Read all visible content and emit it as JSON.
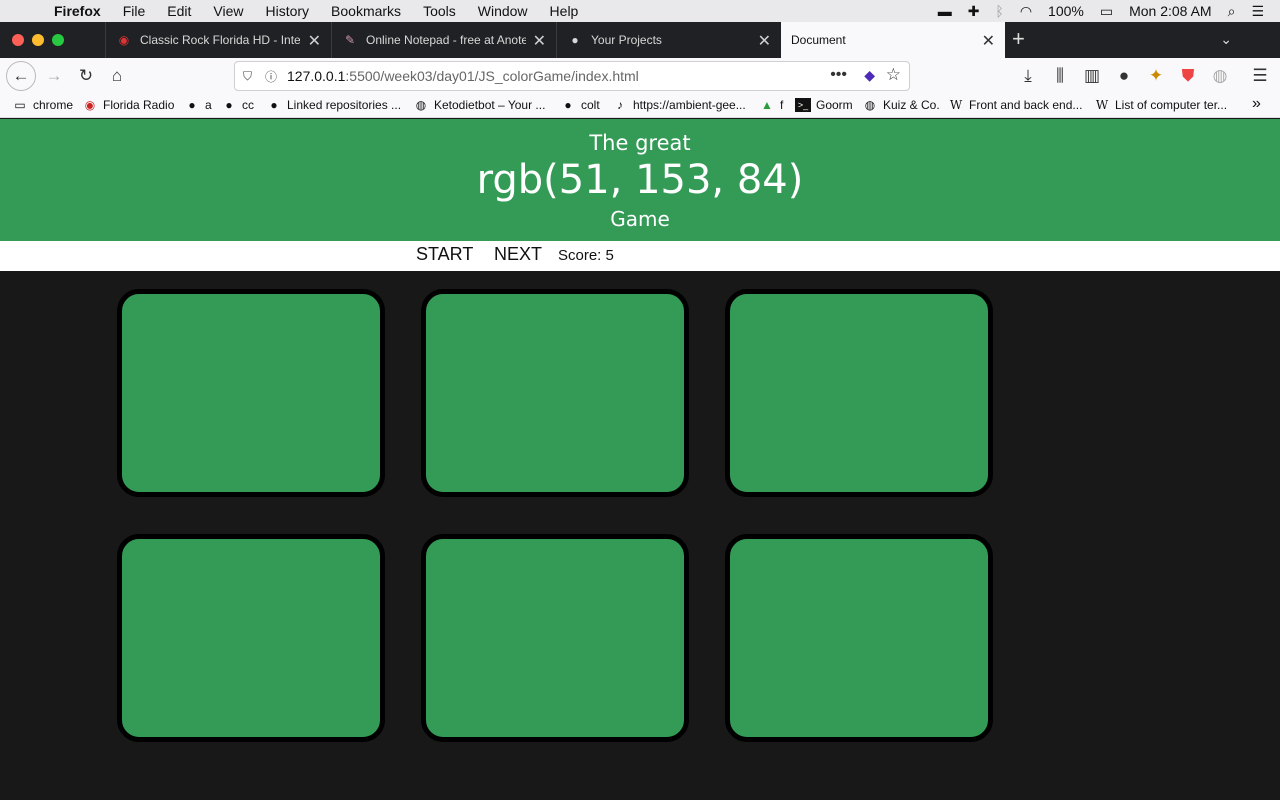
{
  "menubar": {
    "app": "Firefox",
    "items": [
      "File",
      "Edit",
      "View",
      "History",
      "Bookmarks",
      "Tools",
      "Window",
      "Help"
    ],
    "battery": "100%",
    "clock": "Mon 2:08 AM"
  },
  "tabs": [
    {
      "title": "Classic Rock Florida HD - Intern",
      "icon": "radio-icon"
    },
    {
      "title": "Online Notepad - free at Anotep",
      "icon": "notepad-icon"
    },
    {
      "title": "Your Projects",
      "icon": "github-icon"
    },
    {
      "title": "Document",
      "icon": "document-icon",
      "active": true
    }
  ],
  "url": {
    "host": "127.0.0.1",
    "path": ":5500/week03/day01/JS_colorGame/index.html"
  },
  "bookmarks": [
    {
      "label": "chrome",
      "icon": "folder-icon"
    },
    {
      "label": "Florida Radio",
      "icon": "radio-icon"
    },
    {
      "label": "a",
      "icon": "github-icon"
    },
    {
      "label": "cc",
      "icon": "github-icon"
    },
    {
      "label": "Linked repositories ...",
      "icon": "github-icon"
    },
    {
      "label": "Ketodietbot – Your ...",
      "icon": "globe-icon"
    },
    {
      "label": "colt",
      "icon": "github-icon"
    },
    {
      "label": "https://ambient-gee...",
      "icon": "music-note-icon"
    },
    {
      "label": "f",
      "icon": "drive-icon"
    },
    {
      "label": "Goorm",
      "icon": "terminal-icon"
    },
    {
      "label": "Kuiz & Co.",
      "icon": "globe-icon"
    },
    {
      "label": "Front and back end...",
      "icon": "wikipedia-icon"
    },
    {
      "label": "List of computer ter...",
      "icon": "wikipedia-icon"
    }
  ],
  "game": {
    "title_top": "The great",
    "target_color": "rgb(51, 153, 84)",
    "title_bottom": "Game",
    "start_label": "START",
    "next_label": "NEXT",
    "score_label": "Score: 5",
    "header_color": "#349b57",
    "squares": [
      {
        "color": "#349b57"
      },
      {
        "color": "#349b57"
      },
      {
        "color": "#349b57"
      },
      {
        "color": "#349b57"
      },
      {
        "color": "#349b57"
      },
      {
        "color": "#349b57"
      }
    ]
  }
}
